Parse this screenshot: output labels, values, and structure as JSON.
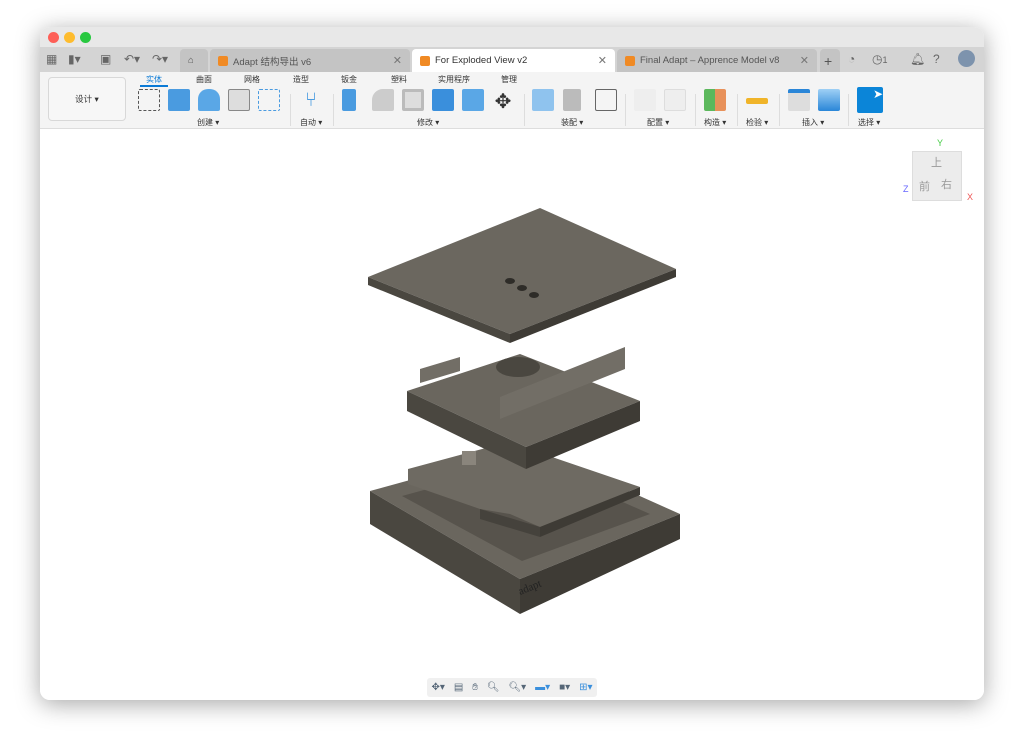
{
  "window": {
    "traffic_lights": [
      "#fe5f57",
      "#febc2e",
      "#28c840"
    ]
  },
  "tabbar": {
    "icons": [
      "grid-icon",
      "file-icon",
      "save-icon",
      "undo-icon",
      "redo-icon",
      "home-icon"
    ],
    "tabs": [
      {
        "label": "Adapt 结构导出 v6",
        "active": false
      },
      {
        "label": "For Exploded View v2",
        "active": true
      },
      {
        "label": "Final Adapt – Apprence Model v8",
        "active": false
      }
    ],
    "job_count": "1"
  },
  "toolbar": {
    "workspace": "设计 ▾",
    "ribbon_tabs": [
      "实体",
      "曲面",
      "网格",
      "造型",
      "钣金",
      "塑料",
      "实用程序",
      "管理"
    ],
    "groups": [
      "创建 ▾",
      "自动 ▾",
      "修改 ▾",
      "装配 ▾",
      "配置 ▾",
      "构造 ▾",
      "检验 ▾",
      "插入 ▾",
      "选择 ▾"
    ]
  },
  "viewcube": {
    "top": "上",
    "front": "前",
    "right": "右",
    "axes": [
      "Y",
      "Z",
      "X"
    ]
  },
  "model": {
    "logo_text": "adapt",
    "color": "#5e5a52"
  },
  "navbar": {
    "icons": [
      "orbit-icon",
      "look-at-icon",
      "pan-icon",
      "zoom-window-icon",
      "zoom-icon",
      "display-icon",
      "visual-style-icon",
      "grid-icon"
    ]
  }
}
